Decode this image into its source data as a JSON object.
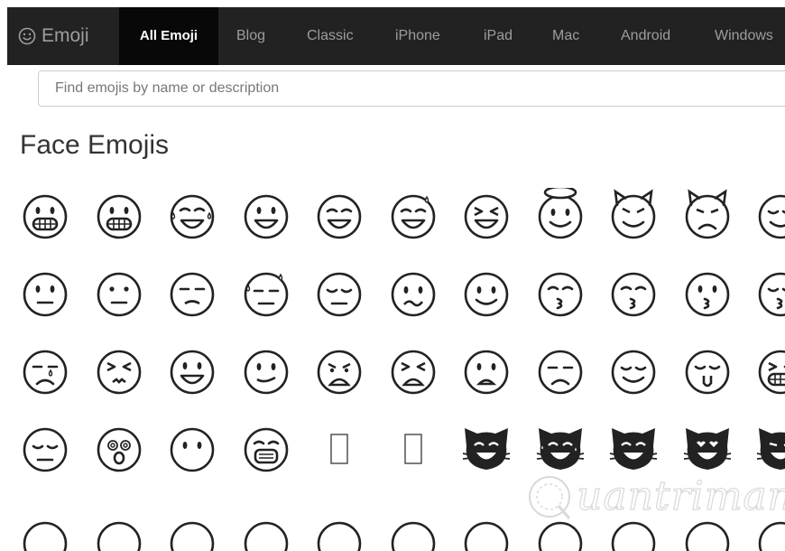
{
  "header": {
    "brand": {
      "icon": "smiley-icon",
      "label": "Emoji"
    },
    "nav": [
      {
        "label": "All Emoji",
        "active": true
      },
      {
        "label": "Blog"
      },
      {
        "label": "Classic"
      },
      {
        "label": "iPhone"
      },
      {
        "label": "iPad"
      },
      {
        "label": "Mac"
      },
      {
        "label": "Android"
      },
      {
        "label": "Windows"
      }
    ],
    "colors": {
      "bar": "#222222",
      "active_bg": "#080808",
      "text": "#9d9d9d",
      "active_text": "#ffffff"
    }
  },
  "search": {
    "placeholder": "Find emojis by name or description",
    "value": ""
  },
  "section": {
    "title": "Face Emojis"
  },
  "emoji_grid": {
    "rows": [
      [
        "grimacing-face-icon",
        "grinning-face-icon",
        "face-with-tears-of-joy-icon",
        "smiling-face-open-mouth-icon",
        "smiling-face-open-mouth-smiling-eyes-icon",
        "smiling-face-open-mouth-cold-sweat-icon",
        "smiling-face-open-mouth-tightly-closed-eyes-icon",
        "smiling-face-with-halo-icon",
        "smiling-face-with-horns-icon",
        "imp-icon",
        "winking-face-icon"
      ],
      [
        "neutral-face-icon",
        "expressionless-face-icon",
        "unamused-face-icon",
        "face-with-cold-sweat-icon",
        "pensive-face-icon",
        "confused-face-icon",
        "upside-down-smile-face-icon",
        "kissing-face-smiling-eyes-icon",
        "kissing-face-closed-eyes-icon",
        "kissing-face-icon",
        "face-throwing-kiss-icon"
      ],
      [
        "crying-face-icon",
        "persevering-face-icon",
        "grinning-face-with-big-eyes-icon",
        "smirking-face-icon",
        "angry-face-icon",
        "tired-face-icon",
        "frowning-face-icon",
        "worried-face-icon",
        "relieved-face-icon",
        "face-with-tongue-icon",
        "face-with-stuck-out-tongue-icon"
      ],
      [
        "sleepy-face-icon",
        "dizzy-face-icon",
        "face-without-mouth-icon",
        "face-with-medical-mask-icon",
        "missing-glyph-icon",
        "missing-glyph-icon",
        "smiling-cat-open-mouth-icon",
        "cat-face-with-tears-of-joy-icon",
        "grinning-cat-icon",
        "cat-face-with-heart-eyes-icon",
        "cat-face-with-wry-smile-icon"
      ]
    ]
  },
  "watermark": {
    "icon": "quantrimang-logo-icon",
    "text": "uantrimang"
  }
}
